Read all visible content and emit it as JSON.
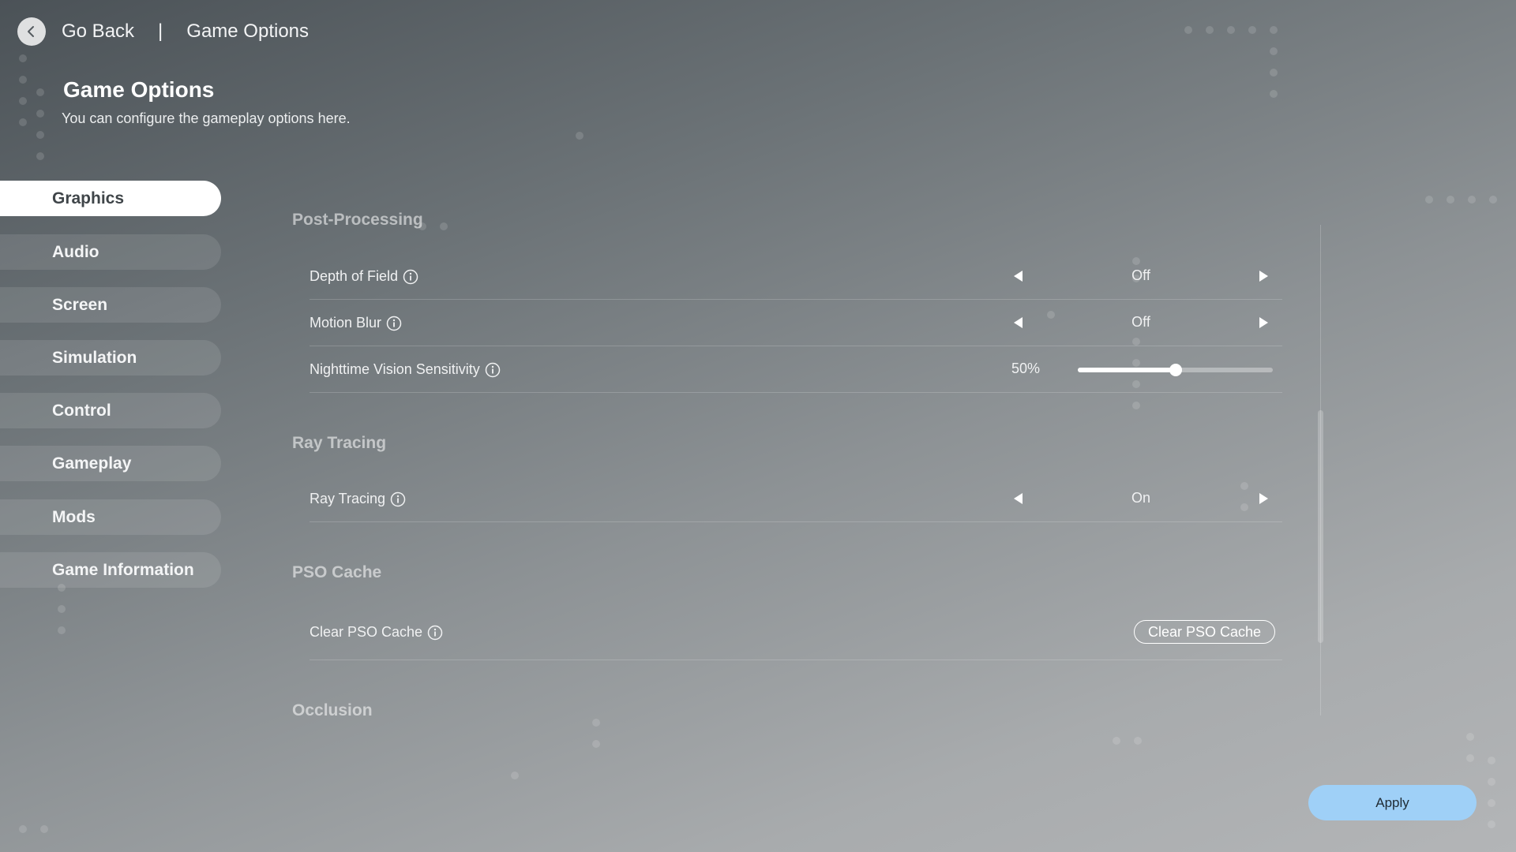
{
  "header": {
    "back_label": "Go Back",
    "separator": "|",
    "breadcrumb": "Game Options",
    "title": "Game Options",
    "subtitle": "You can configure the gameplay options here."
  },
  "sidebar": {
    "items": [
      {
        "label": "Graphics",
        "active": true
      },
      {
        "label": "Audio",
        "active": false
      },
      {
        "label": "Screen",
        "active": false
      },
      {
        "label": "Simulation",
        "active": false
      },
      {
        "label": "Control",
        "active": false
      },
      {
        "label": "Gameplay",
        "active": false
      },
      {
        "label": "Mods",
        "active": false
      },
      {
        "label": "Game Information",
        "active": false
      }
    ]
  },
  "sections": {
    "post_processing": {
      "title": "Post-Processing",
      "depth_of_field": {
        "label": "Depth of Field",
        "value": "Off"
      },
      "motion_blur": {
        "label": "Motion Blur",
        "value": "Off"
      },
      "nighttime_vision": {
        "label": "Nighttime Vision Sensitivity",
        "value_text": "50%",
        "value": 0.5
      }
    },
    "ray_tracing": {
      "title": "Ray Tracing",
      "ray_tracing": {
        "label": "Ray Tracing",
        "value": "On"
      }
    },
    "pso_cache": {
      "title": "PSO Cache",
      "clear": {
        "label": "Clear PSO Cache",
        "button_label": "Clear PSO Cache"
      }
    },
    "occlusion": {
      "title": "Occlusion"
    }
  },
  "footer": {
    "apply_label": "Apply"
  },
  "colors": {
    "accent": "#9fd0f7",
    "active_nav_bg": "#ffffff",
    "active_nav_text": "#3f4549"
  },
  "icons": {
    "back": "chevron-left-icon",
    "info": "info-icon",
    "prev": "triangle-left-icon",
    "next": "triangle-right-icon"
  }
}
